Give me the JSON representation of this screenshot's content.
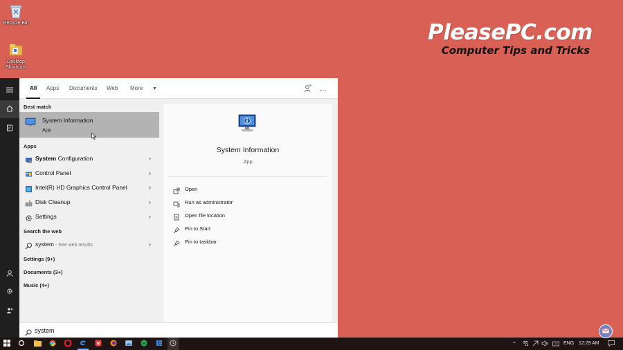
{
  "desktop": {
    "icons": [
      {
        "label": "Recycle Bin",
        "icon": "recycle-bin-icon"
      },
      {
        "label": "Desktop Shortcuts",
        "icon": "folder-icon"
      }
    ]
  },
  "watermark": {
    "site": "PleasePC.com",
    "tagline": "Computer Tips and Tricks"
  },
  "filters": {
    "tabs": [
      {
        "label": "All",
        "active": true
      },
      {
        "label": "Apps"
      },
      {
        "label": "Documents"
      },
      {
        "label": "Web"
      },
      {
        "label": "More"
      }
    ],
    "feedback_icon": "feedback-icon",
    "more_options_icon": "ellipsis-icon"
  },
  "results": {
    "best_match_header": "Best match",
    "best_match": {
      "title": "System Information",
      "subtitle": "App"
    },
    "apps_header": "Apps",
    "apps": [
      {
        "bold": "System",
        "rest": " Configuration",
        "icon": "msconfig-icon"
      },
      {
        "bold": "",
        "rest": "Control Panel",
        "icon": "control-panel-icon"
      },
      {
        "bold": "",
        "rest": "Intel(R) HD Graphics Control Panel",
        "icon": "intel-graphics-icon"
      },
      {
        "bold": "",
        "rest": "Disk Cleanup",
        "icon": "disk-cleanup-icon"
      },
      {
        "bold": "",
        "rest": "Settings",
        "icon": "gear-icon"
      }
    ],
    "web_header": "Search the web",
    "web_query": "system",
    "web_suffix": " - See web results",
    "settings_header": "Settings (9+)",
    "documents_header": "Documents (3+)",
    "music_header": "Music (4+)"
  },
  "preview": {
    "title": "System Information",
    "subtitle": "App",
    "actions": [
      {
        "label": "Open",
        "icon": "open-icon"
      },
      {
        "label": "Run as administrator",
        "icon": "run-as-admin-icon"
      },
      {
        "label": "Open file location",
        "icon": "file-location-icon"
      },
      {
        "label": "Pin to Start",
        "icon": "pin-icon"
      },
      {
        "label": "Pin to taskbar",
        "icon": "pin-icon"
      }
    ]
  },
  "search": {
    "value": "system"
  },
  "taskbar": {
    "language": "ENG",
    "time": "12:29 AM"
  },
  "colors": {
    "desktop": "#d96055",
    "best_match_highlight": "#b3b3b3",
    "taskbar": "#1e1414"
  }
}
